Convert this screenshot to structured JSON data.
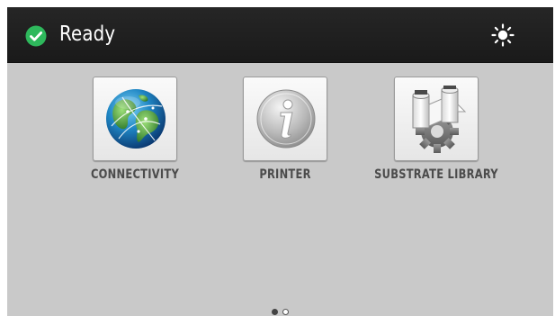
{
  "status": {
    "text": "Ready",
    "icon": "check-circle-icon",
    "icon_color": "#2eb85c"
  },
  "header": {
    "brightness_icon": "sun-icon"
  },
  "apps": [
    {
      "label": "CONNECTIVITY",
      "icon": "globe-icon"
    },
    {
      "label": "PRINTER",
      "icon": "info-icon"
    },
    {
      "label": "SUBSTRATE LIBRARY",
      "icon": "substrate-rolls-gear-icon"
    }
  ],
  "pager": {
    "current_page": 1,
    "total_pages": 2
  },
  "colors": {
    "header_bg": "#1f1f1f",
    "screen_bg": "#c9c9c9",
    "label_text": "#4b4b4b"
  }
}
